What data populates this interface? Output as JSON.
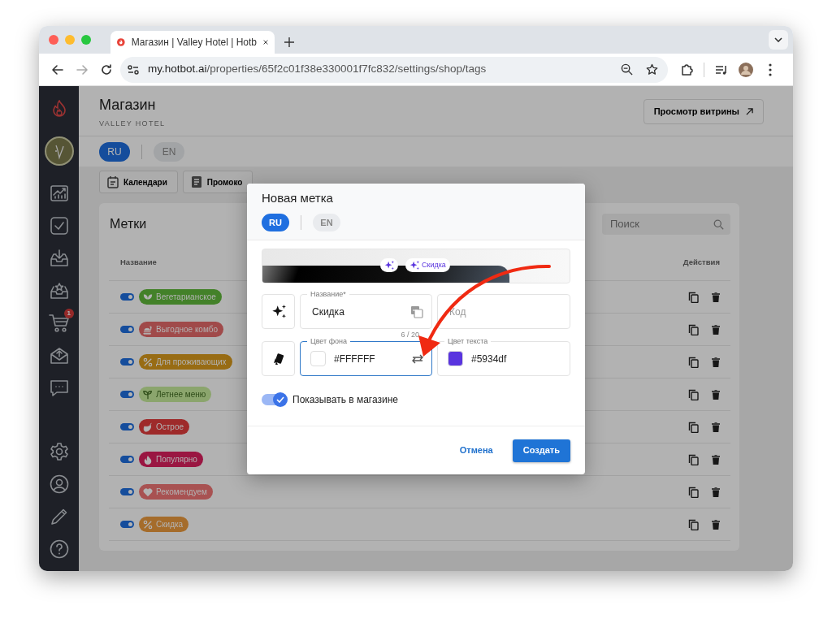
{
  "browser": {
    "tab_title": "Магазин | Valley Hotel | Hotb",
    "url_host": "my.hotbot.ai",
    "url_path": "/properties/65f2c01f38e330001f7fc832/settings/shop/tags"
  },
  "sidebar": {
    "cart_badge": "1"
  },
  "page": {
    "title": "Магазин",
    "subtitle": "VALLEY HOTEL",
    "storefront_button": "Просмотр витрины",
    "languages": [
      {
        "label": "RU",
        "selected": true
      },
      {
        "label": "EN",
        "selected": false
      }
    ],
    "sections": [
      {
        "label": "Календари"
      },
      {
        "label": "Промоко"
      }
    ]
  },
  "tags_card": {
    "title": "Метки",
    "search": {
      "placeholder": "Поиск"
    },
    "columns": [
      "Название",
      "Действия"
    ],
    "rows": [
      {
        "label": "Вегетарианское",
        "on": true,
        "color": "#438129"
      },
      {
        "label": "Выгодное комбо",
        "on": true,
        "color": "#a04a4a"
      },
      {
        "label": "Для проживающих",
        "on": true,
        "color": "#986c14"
      },
      {
        "label": "Летнее меню",
        "on": true,
        "color": "#8ba56d"
      },
      {
        "label": "Острое",
        "on": true,
        "color": "#9e2a2a"
      },
      {
        "label": "Популярно",
        "on": true,
        "color": "#9a1642"
      },
      {
        "label": "Рекомендуем",
        "on": true,
        "color": "#a85252"
      },
      {
        "label": "Скидка",
        "on": true,
        "color": "#a56c2b"
      }
    ]
  },
  "dialog": {
    "title": "Новая метка",
    "languages": [
      {
        "label": "RU",
        "selected": true
      },
      {
        "label": "EN",
        "selected": false
      }
    ],
    "preview_label": "Скидка",
    "name_field": {
      "label": "Название*",
      "value": "Скидка",
      "counter": "6 / 20"
    },
    "code_field": {
      "placeholder": "Код"
    },
    "bg_color_field": {
      "label": "Цвет фона",
      "value": "#FFFFFF",
      "focused": true
    },
    "text_color_field": {
      "label": "Цвет текста",
      "value": "#5934df",
      "focused": false
    },
    "show_in_shop": {
      "label": "Показывать в магазине",
      "checked": true
    },
    "cancel_button": "Отмена",
    "create_button": "Создать"
  }
}
